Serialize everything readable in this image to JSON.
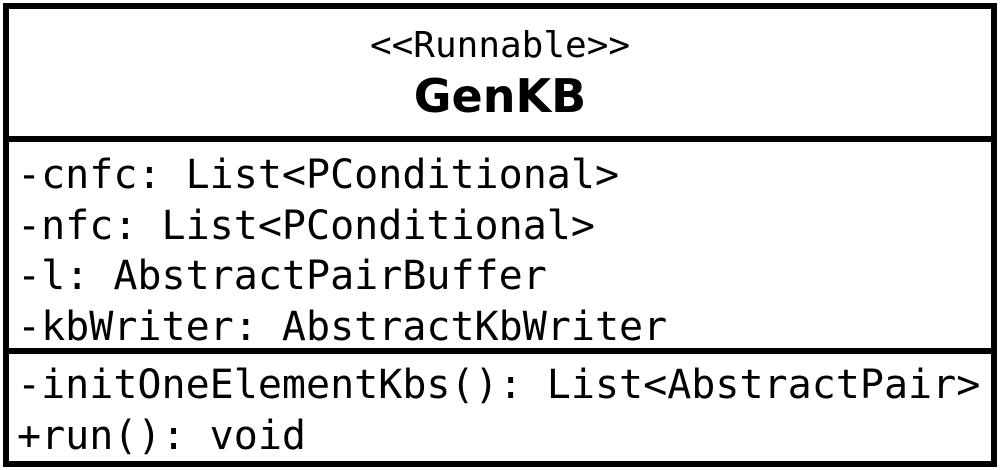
{
  "class_box": {
    "stereotype": "<<Runnable>>",
    "name": "GenKB",
    "attributes": [
      "-cnfc: List<PConditional>",
      "-nfc: List<PConditional>",
      "-l: AbstractPairBuffer",
      "-kbWriter: AbstractKbWriter"
    ],
    "operations": [
      "-initOneElementKbs(): List<AbstractPair>",
      "+run(): void"
    ]
  }
}
